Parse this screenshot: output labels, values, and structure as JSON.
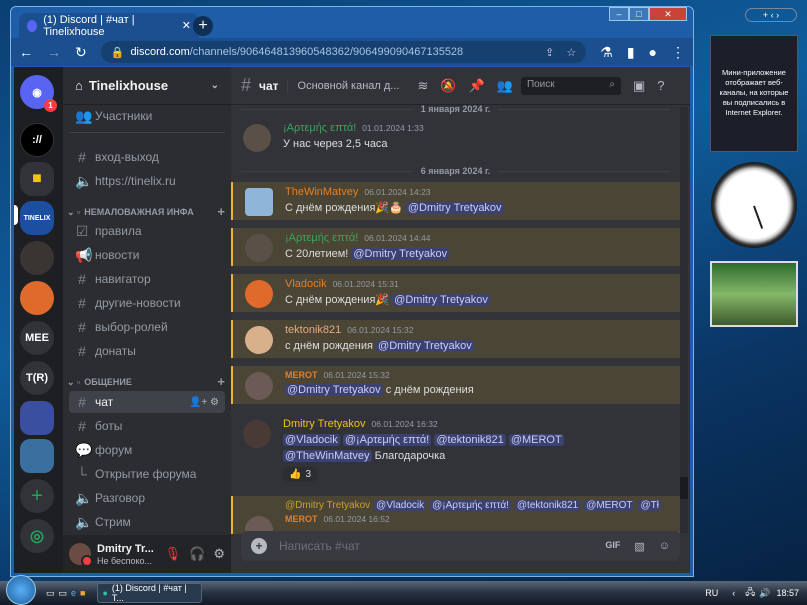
{
  "browser": {
    "tab_title": "(1) Discord | #чат | Tinelixhouse",
    "tab_badge": "1",
    "url_domain": "discord.com",
    "url_path": "/channels/906464813960548362/906499090467135528"
  },
  "servers": {
    "badge": "1",
    "items": [
      "MEE",
      "T(R)"
    ]
  },
  "guild": {
    "name": "Tinelixhouse",
    "members_label": "Участники",
    "channels_top": [
      {
        "icon": "hash-icon",
        "label": "вход-выход"
      },
      {
        "icon": "speaker-icon",
        "label": "https://tinelix.ru"
      }
    ],
    "category1": "НЕМАЛОВАЖНАЯ ИНФА",
    "channels_cat1": [
      {
        "icon": "rules-icon",
        "label": "правила"
      },
      {
        "icon": "megaphone-icon",
        "label": "новости"
      },
      {
        "icon": "hash-icon",
        "label": "навигатор"
      },
      {
        "icon": "hash-icon",
        "label": "другие-новости"
      },
      {
        "icon": "hash-icon",
        "label": "выбор-ролей"
      },
      {
        "icon": "hash-icon",
        "label": "донаты"
      }
    ],
    "category2": "ОБЩЕНИЕ",
    "channels_cat2": [
      {
        "icon": "hash-icon",
        "label": "чат"
      },
      {
        "icon": "hash-icon",
        "label": "боты"
      },
      {
        "icon": "forum-icon",
        "label": "форум"
      },
      {
        "icon": "thread-icon",
        "label": "Открытие форума"
      },
      {
        "icon": "speaker-icon",
        "label": "Разговор"
      },
      {
        "icon": "speaker-icon",
        "label": "Стрим"
      }
    ]
  },
  "user": {
    "name": "Dmitry Tr...",
    "status": "Не беспоко..."
  },
  "chat": {
    "channel": "чат",
    "topic": "Основной канал д...",
    "search_placeholder": "Поиск",
    "input_placeholder": "Написать #чат",
    "gif": "GIF",
    "divider1": "1 января 2024 г.",
    "divider2": "6 января 2024 г.",
    "messages": [
      {
        "author": "¡Αρτεμής επτά!",
        "color": "#3ba55c",
        "time": "01.01.2024 1:33",
        "text": "У нас через 2,5 часа"
      },
      {
        "author": "TheWinMatvey",
        "color": "#e67e22",
        "time": "06.01.2024 14:23",
        "text": "С днём рождения🎉🎂",
        "mention": "@Dmitry Tretyakov"
      },
      {
        "author": "¡Αρτεμής επτά!",
        "color": "#3ba55c",
        "time": "06.01.2024 14:44",
        "text": "С 20летием!",
        "mention": "@Dmitry Tretyakov"
      },
      {
        "author": "Vladocik",
        "color": "#e67e22",
        "time": "06.01.2024 15:31",
        "text": "С днём рождения🎉",
        "mention": "@Dmitry Tretyakov"
      },
      {
        "author": "tektonik821",
        "color": "#e8a87c",
        "time": "06.01.2024 15:32",
        "text": "с днём рождения",
        "mention": "@Dmitry Tretyakov"
      },
      {
        "author": "MEROT",
        "color": "#e67e22",
        "time": "06.01.2024 15:32",
        "mention": "@Dmitry Tretyakov",
        "text": "с днём рождения"
      },
      {
        "author": "Dmitry Tretyakov",
        "color": "#f1c40f",
        "time": "06.01.2024 16:32",
        "mentions": [
          "@Vladocik",
          "@¡Αρτεμής επτά!",
          "@tektonik821",
          "@MEROT",
          "@TheWinMatvey"
        ],
        "text": "Благодарочка",
        "reaction": "👍",
        "reaction_count": "3"
      },
      {
        "author": "MEROT",
        "color": "#e67e22",
        "time": "06.01.2024 16:52",
        "reply_author": "@Dmitry Tretyakov",
        "reply_mentions": [
          "@Vladocik",
          "@¡Αρτεμής επτά!",
          "@tektonik821",
          "@MEROT",
          "@Tł"
        ]
      }
    ]
  },
  "gadget": {
    "text": "Мини-приложение отображает веб-каналы, на которые вы подписались в Internet Explorer."
  },
  "taskbar": {
    "task": "(1) Discord | #чат | T...",
    "lang": "RU",
    "time": "18:57"
  }
}
